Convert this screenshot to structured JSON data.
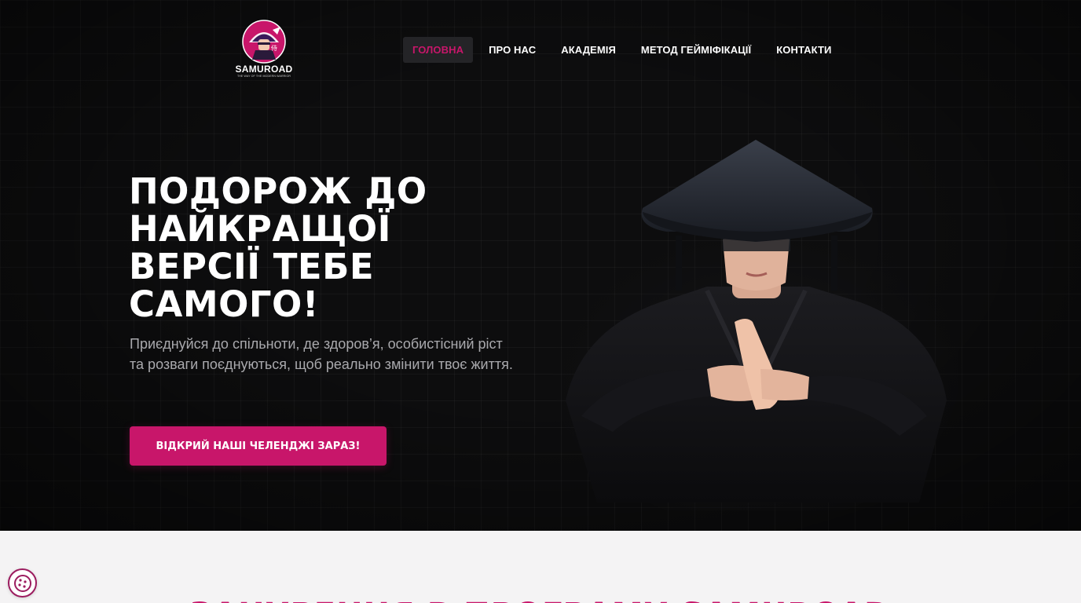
{
  "brand": {
    "name": "SAMUROAD",
    "tagline": "THE WAY OF THE MODERN WARRIOR",
    "accent_color": "#c8166a",
    "logo_icon": "samurai-head-logo"
  },
  "nav": {
    "items": [
      {
        "label": "ГОЛОВНА",
        "active": true
      },
      {
        "label": "ПРО НАС",
        "active": false
      },
      {
        "label": "АКАДЕМІЯ",
        "active": false
      },
      {
        "label": "МЕТОД ГЕЙМІФІКАЦІЇ",
        "active": false
      },
      {
        "label": "КОНТАКТИ",
        "active": false
      }
    ]
  },
  "hero": {
    "title": "ПОДОРОЖ ДО НАЙКРАЩОЇ ВЕРСІЇ ТЕБЕ САМОГО!",
    "subtitle": "Приєднуйся до спільноти, де здоров’я, особистісний ріст та розваги поєднуються, щоб реально змінити твоє життя.",
    "cta_label": "ВІДКРИЙ НАШІ ЧЕЛЕНДЖІ ЗАРАЗ!",
    "image": "samurai-in-straw-hat"
  },
  "next_section": {
    "heading": "ЗАНУРЕННЯ В ПРОГРАМУ SAMUROAD"
  },
  "cookie": {
    "icon": "cookie-icon"
  }
}
